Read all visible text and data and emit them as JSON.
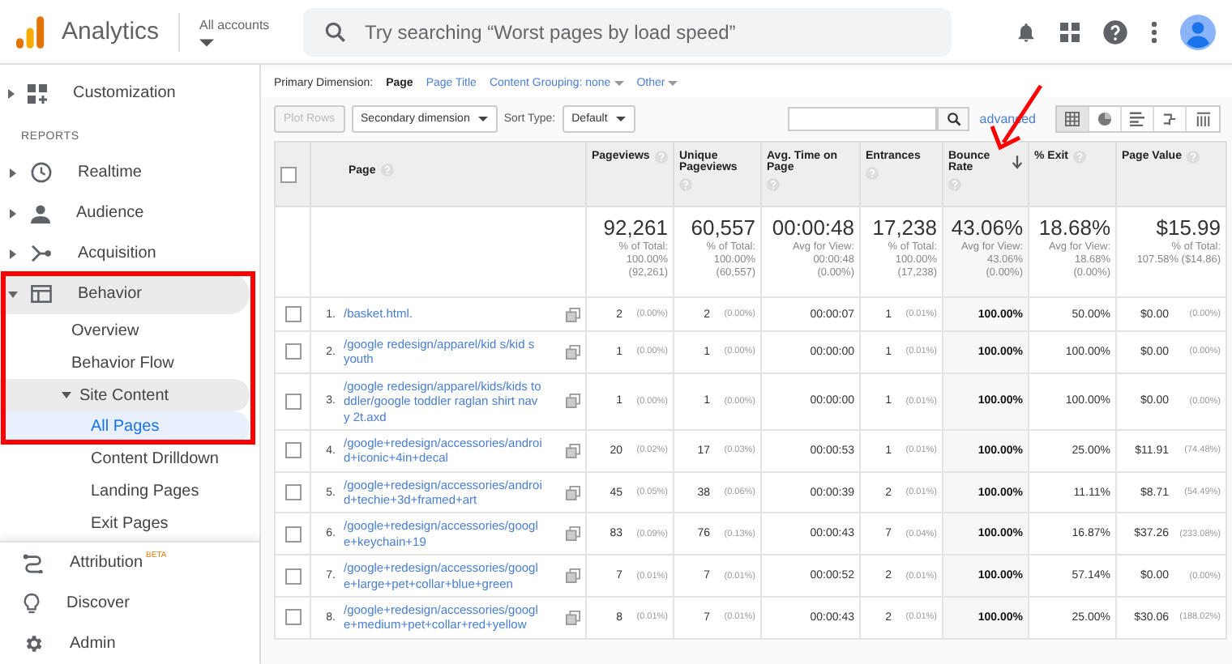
{
  "header": {
    "logo_text": "Analytics",
    "account": "All accounts",
    "search_placeholder": "Try searching “Worst pages by load speed”"
  },
  "sidebar": {
    "top_items": [
      {
        "label": "Customization",
        "expanded": false
      }
    ],
    "section_label": "REPORTS",
    "reports": [
      {
        "label": "Realtime",
        "expanded": false,
        "selected": false
      },
      {
        "label": "Audience",
        "expanded": false,
        "selected": false
      },
      {
        "label": "Acquisition",
        "expanded": false,
        "selected": false
      },
      {
        "label": "Behavior",
        "expanded": true,
        "selected": true,
        "children": [
          {
            "label": "Overview",
            "selected": false
          },
          {
            "label": "Behavior Flow",
            "selected": false
          },
          {
            "label": "Site Content",
            "expanded": true,
            "selected": true,
            "children": [
              {
                "label": "All Pages",
                "selected": true
              },
              {
                "label": "Content Drilldown",
                "selected": false
              },
              {
                "label": "Landing Pages",
                "selected": false
              },
              {
                "label": "Exit Pages",
                "selected": false
              }
            ]
          }
        ]
      }
    ],
    "footer": [
      {
        "label": "Attribution",
        "badge": "BETA"
      },
      {
        "label": "Discover"
      },
      {
        "label": "Admin"
      }
    ]
  },
  "dimensions": {
    "label": "Primary Dimension:",
    "options": [
      {
        "label": "Page",
        "selected": true,
        "dropdown": false
      },
      {
        "label": "Page Title",
        "selected": false,
        "dropdown": false
      },
      {
        "label": "Content Grouping: none",
        "selected": false,
        "dropdown": true
      },
      {
        "label": "Other",
        "selected": false,
        "dropdown": true
      }
    ]
  },
  "controls": {
    "plot_rows": {
      "label": "Plot Rows",
      "disabled": true
    },
    "secondary": "Secondary dimension",
    "sort_label": "Sort Type:",
    "sort_value": "Default",
    "advanced": "advanced",
    "view_modes": [
      {
        "selected": true
      },
      {
        "selected": false
      },
      {
        "selected": false
      },
      {
        "selected": false
      },
      {
        "selected": false
      }
    ]
  },
  "table": {
    "select_all_checked": false,
    "columns": [
      {
        "label": "Page",
        "sorted": false
      },
      {
        "label": "Pageviews",
        "sorted": false
      },
      {
        "label": "Unique Pageviews",
        "sorted": false
      },
      {
        "label": "Avg. Time on Page",
        "sorted": false
      },
      {
        "label": "Entrances",
        "sorted": false
      },
      {
        "label": "Bounce Rate",
        "sorted": true
      },
      {
        "label": "% Exit",
        "sorted": false
      },
      {
        "label": "Page Value",
        "sorted": false
      }
    ],
    "totals": [
      {
        "value": "92,261",
        "lines": [
          "% of Total:",
          "100.00%",
          "(92,261)"
        ]
      },
      {
        "value": "60,557",
        "lines": [
          "% of Total:",
          "100.00%",
          "(60,557)"
        ]
      },
      {
        "value": "00:00:48",
        "lines": [
          "Avg for View:",
          "00:00:48",
          "(0.00%)"
        ]
      },
      {
        "value": "17,238",
        "lines": [
          "% of Total:",
          "100.00%",
          "(17,238)"
        ]
      },
      {
        "value": "43.06%",
        "lines": [
          "Avg for View:",
          "43.06%",
          "(0.00%)"
        ]
      },
      {
        "value": "18.68%",
        "lines": [
          "Avg for View:",
          "18.68%",
          "(0.00%)"
        ]
      },
      {
        "value": "$15.99",
        "lines": [
          "% of Total:",
          "107.58% ($14.86)"
        ]
      }
    ],
    "rows": [
      {
        "checked": false,
        "num": "1.",
        "page": "/basket.html.",
        "pageviews": "2",
        "pageviews_pct": "(0.00%)",
        "unique": "2",
        "unique_pct": "(0.00%)",
        "avg_time": "00:00:07",
        "entrances": "1",
        "entrances_pct": "(0.01%)",
        "bounce": "100.00%",
        "exit": "50.00%",
        "value": "$0.00",
        "value_pct": "(0.00%)"
      },
      {
        "checked": false,
        "num": "2.",
        "page": "/google redesign/apparel/kid s/kid s youth",
        "pageviews": "1",
        "pageviews_pct": "(0.00%)",
        "unique": "1",
        "unique_pct": "(0.00%)",
        "avg_time": "00:00:00",
        "entrances": "1",
        "entrances_pct": "(0.01%)",
        "bounce": "100.00%",
        "exit": "100.00%",
        "value": "$0.00",
        "value_pct": "(0.00%)"
      },
      {
        "checked": false,
        "num": "3.",
        "page": "/google redesign/apparel/kids/kids toddler/google toddler raglan shirt navy 2t.axd",
        "pageviews": "1",
        "pageviews_pct": "(0.00%)",
        "unique": "1",
        "unique_pct": "(0.00%)",
        "avg_time": "00:00:00",
        "entrances": "1",
        "entrances_pct": "(0.01%)",
        "bounce": "100.00%",
        "exit": "100.00%",
        "value": "$0.00",
        "value_pct": "(0.00%)"
      },
      {
        "checked": false,
        "num": "4.",
        "page": "/google+redesign/accessories/android+iconic+4in+decal",
        "pageviews": "20",
        "pageviews_pct": "(0.02%)",
        "unique": "17",
        "unique_pct": "(0.03%)",
        "avg_time": "00:00:53",
        "entrances": "1",
        "entrances_pct": "(0.01%)",
        "bounce": "100.00%",
        "exit": "25.00%",
        "value": "$11.91",
        "value_pct": "(74.48%)"
      },
      {
        "checked": false,
        "num": "5.",
        "page": "/google+redesign/accessories/android+techie+3d+framed+art",
        "pageviews": "45",
        "pageviews_pct": "(0.05%)",
        "unique": "38",
        "unique_pct": "(0.06%)",
        "avg_time": "00:00:39",
        "entrances": "2",
        "entrances_pct": "(0.01%)",
        "bounce": "100.00%",
        "exit": "11.11%",
        "value": "$8.71",
        "value_pct": "(54.49%)"
      },
      {
        "checked": false,
        "num": "6.",
        "page": "/google+redesign/accessories/google+keychain+19",
        "pageviews": "83",
        "pageviews_pct": "(0.09%)",
        "unique": "76",
        "unique_pct": "(0.13%)",
        "avg_time": "00:00:43",
        "entrances": "7",
        "entrances_pct": "(0.04%)",
        "bounce": "100.00%",
        "exit": "16.87%",
        "value": "$37.26",
        "value_pct": "(233.08%)"
      },
      {
        "checked": false,
        "num": "7.",
        "page": "/google+redesign/accessories/google+large+pet+collar+blue+green",
        "pageviews": "7",
        "pageviews_pct": "(0.01%)",
        "unique": "7",
        "unique_pct": "(0.01%)",
        "avg_time": "00:00:52",
        "entrances": "2",
        "entrances_pct": "(0.01%)",
        "bounce": "100.00%",
        "exit": "57.14%",
        "value": "$0.00",
        "value_pct": "(0.00%)"
      },
      {
        "checked": false,
        "num": "8.",
        "page": "/google+redesign/accessories/google+medium+pet+collar+red+yellow",
        "pageviews": "8",
        "pageviews_pct": "(0.01%)",
        "unique": "7",
        "unique_pct": "(0.01%)",
        "avg_time": "00:00:43",
        "entrances": "2",
        "entrances_pct": "(0.01%)",
        "bounce": "100.00%",
        "exit": "25.00%",
        "value": "$30.06",
        "value_pct": "(188.02%)"
      }
    ]
  }
}
